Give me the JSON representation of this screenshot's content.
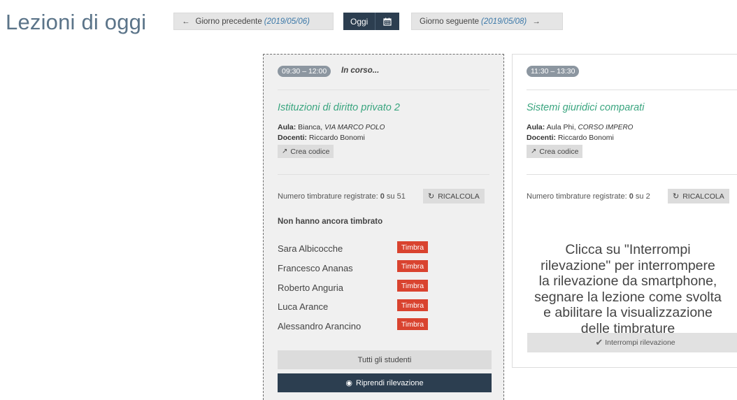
{
  "page": {
    "title": "Lezioni di oggi"
  },
  "nav": {
    "prev_arrow": "←",
    "prev_label": "Giorno precedente",
    "prev_date": "(2019/05/06)",
    "today_label": "Oggi",
    "calendar_icon": "calendar-icon",
    "next_label": "Giorno seguente",
    "next_date": "(2019/05/08)",
    "next_arrow": "→"
  },
  "lessons": [
    {
      "time": "09:30 – 12:00",
      "status": "In corso...",
      "course": "Istituzioni di diritto privato 2",
      "room_label": "Aula:",
      "room": "Bianca,",
      "room_address": "VIA MARCO POLO",
      "teachers_label": "Docenti:",
      "teachers": "Riccardo Bonomi",
      "create_code": "Crea codice",
      "count_prefix": "Numero timbrature registrate:",
      "count_value": "0",
      "count_suffix": "su 51",
      "recalc": "RICALCOLA",
      "not_stamped_heading": "Non hanno ancora timbrato",
      "students": [
        {
          "name": "Sara Albicocche",
          "action": "Timbra"
        },
        {
          "name": "Francesco Ananas",
          "action": "Timbra"
        },
        {
          "name": "Roberto Anguria",
          "action": "Timbra"
        },
        {
          "name": "Luca Arance",
          "action": "Timbra"
        },
        {
          "name": "Alessandro Arancino",
          "action": "Timbra"
        }
      ],
      "all_students": "Tutti gli studenti",
      "resume": "Riprendi rilevazione"
    },
    {
      "time": "11:30 – 13:30",
      "course": "Sistemi giuridici comparati",
      "room_label": "Aula:",
      "room": "Aula Phi,",
      "room_address": "CORSO IMPERO",
      "teachers_label": "Docenti:",
      "teachers": "Riccardo Bonomi",
      "create_code": "Crea codice",
      "count_prefix": "Numero timbrature registrate:",
      "count_value": "0",
      "count_suffix": "su 2",
      "recalc": "RICALCOLA",
      "message_lines": [
        "Clicca su \"Interrompi",
        "rilevazione\" per interrompere",
        "la rilevazione da smartphone,",
        "segnare la lezione come svolta",
        "e abilitare la visualizzazione",
        "delle timbrature"
      ],
      "stop": "Interrompi rilevazione"
    }
  ],
  "colors": {
    "title": "#5b7489",
    "dark_button": "#2c3e50",
    "course_green": "#3aa57f",
    "timbra_red": "#d9432f",
    "date_blue": "#3b78a8"
  }
}
